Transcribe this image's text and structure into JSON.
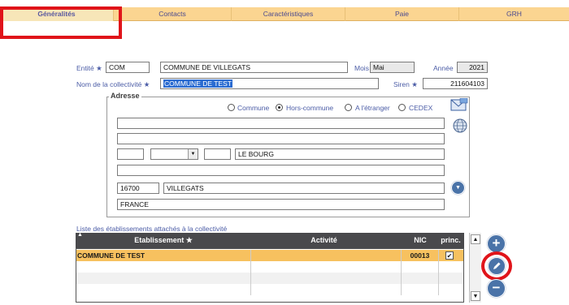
{
  "tabs": [
    {
      "label": "Généralités"
    },
    {
      "label": "Contacts"
    },
    {
      "label": "Caractéristiques"
    },
    {
      "label": "Paie"
    },
    {
      "label": "GRH"
    }
  ],
  "entite": {
    "label": "Entité",
    "code": "COM",
    "name": "COMMUNE DE VILLEGATS"
  },
  "mois": {
    "label": "Mois",
    "value": "Mai"
  },
  "annee": {
    "label": "Année",
    "value": "2021"
  },
  "collectivite": {
    "label": "Nom de la collectivité",
    "value": "COMMUNE DE TEST"
  },
  "siren": {
    "label": "Siren",
    "value": "211604103"
  },
  "adresse": {
    "legend": "Adresse",
    "options": [
      "Commune",
      "Hors-commune",
      "A l'étranger",
      "CEDEX"
    ],
    "selected": "Hors-commune",
    "line1": "",
    "line2": "",
    "numero": "",
    "type_voie": "",
    "complement": "",
    "voie": "LE BOURG",
    "line4": "",
    "code_postal": "16700",
    "ville": "VILLEGATS",
    "pays": "FRANCE"
  },
  "etablissements": {
    "caption": "Liste des établissements attachés à la collectivité",
    "columns": [
      "Etablissement",
      "Activité",
      "NIC",
      "princ."
    ],
    "rows": [
      {
        "etablissement": "COMMUNE DE TEST",
        "activite": "",
        "nic": "00013",
        "principal": true
      }
    ]
  },
  "colors": {
    "tab_bar": "#fbd591",
    "highlight_row": "#f7c15f",
    "label": "#4b5ca6",
    "callout": "#e0141a"
  }
}
